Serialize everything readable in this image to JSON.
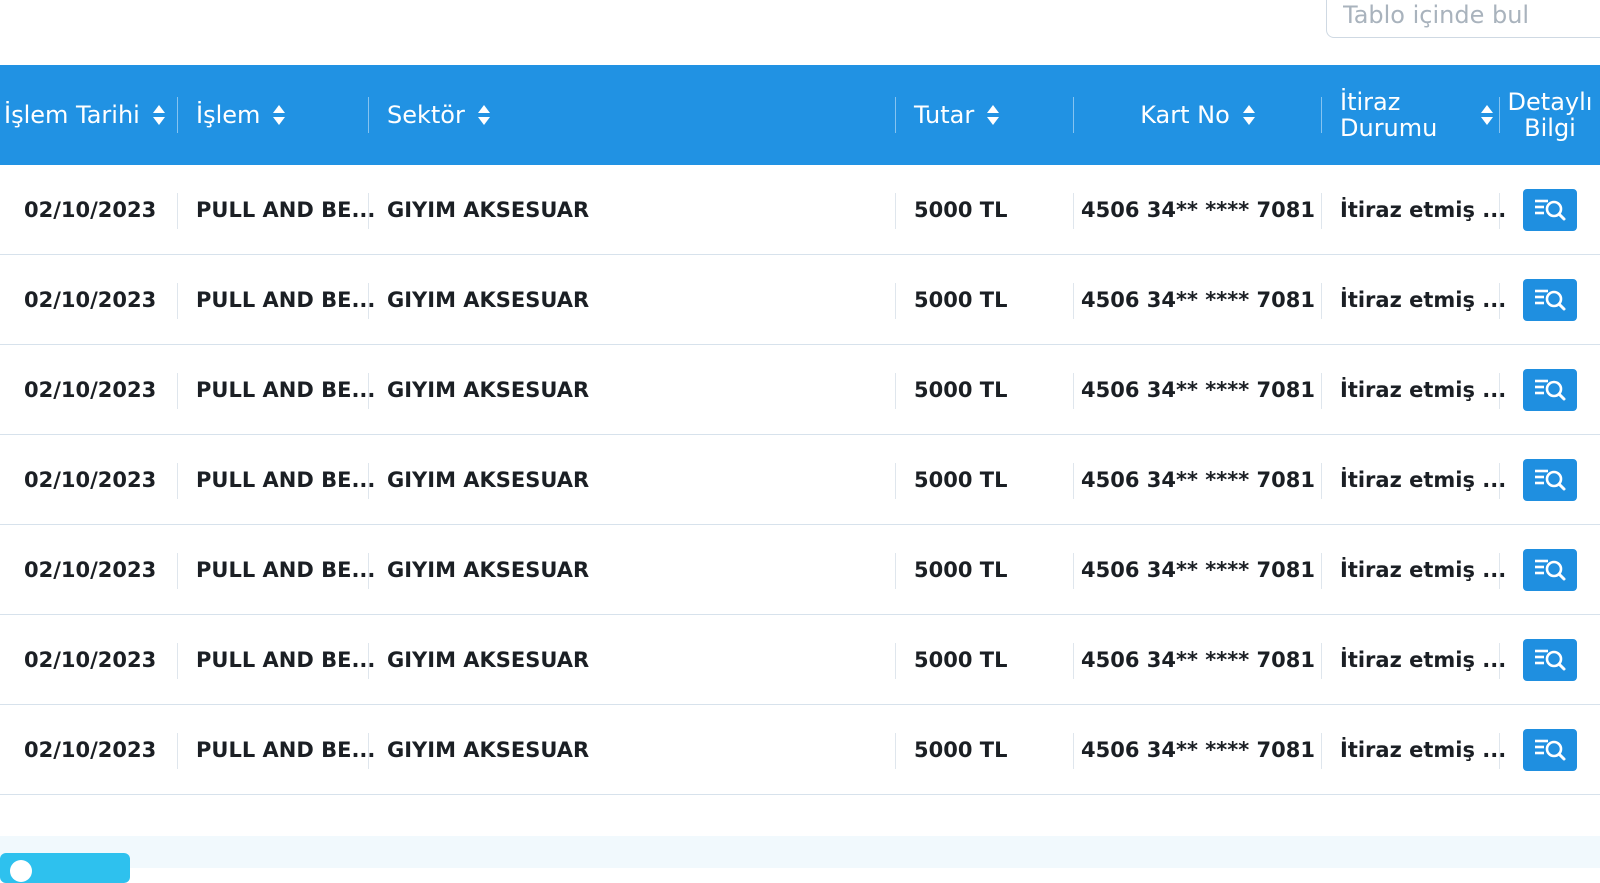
{
  "search": {
    "placeholder": "Tablo içinde bul",
    "icon": "search-icon"
  },
  "colors": {
    "header_bg": "#2192e3",
    "accent": "#1f8fe0",
    "row_border": "#d7e2ec",
    "footer_button": "#2ec1ee"
  },
  "table": {
    "headers": {
      "date": "İşlem Tarihi",
      "transaction": "İşlem",
      "sector": "Sektör",
      "amount": "Tutar",
      "card": "Kart No",
      "objection_line1": "İtiraz",
      "objection_line2": "Durumu",
      "detail_line1": "Detaylı",
      "detail_line2": "Bilgi"
    },
    "rows": [
      {
        "date": "02/10/2023",
        "transaction": "PULL AND BE...",
        "sector": "GIYIM AKSESUAR",
        "amount": "5000 TL",
        "card": "4506 34** **** 7081",
        "objection": "İtiraz etmiş ..."
      },
      {
        "date": "02/10/2023",
        "transaction": "PULL AND BE...",
        "sector": "GIYIM AKSESUAR",
        "amount": "5000 TL",
        "card": "4506 34** **** 7081",
        "objection": "İtiraz etmiş ..."
      },
      {
        "date": "02/10/2023",
        "transaction": "PULL AND BE...",
        "sector": "GIYIM AKSESUAR",
        "amount": "5000 TL",
        "card": "4506 34** **** 7081",
        "objection": "İtiraz etmiş ..."
      },
      {
        "date": "02/10/2023",
        "transaction": "PULL AND BE...",
        "sector": "GIYIM AKSESUAR",
        "amount": "5000 TL",
        "card": "4506 34** **** 7081",
        "objection": "İtiraz etmiş ..."
      },
      {
        "date": "02/10/2023",
        "transaction": "PULL AND BE...",
        "sector": "GIYIM AKSESUAR",
        "amount": "5000 TL",
        "card": "4506 34** **** 7081",
        "objection": "İtiraz etmiş ..."
      },
      {
        "date": "02/10/2023",
        "transaction": "PULL AND BE...",
        "sector": "GIYIM AKSESUAR",
        "amount": "5000 TL",
        "card": "4506 34** **** 7081",
        "objection": "İtiraz etmiş ..."
      },
      {
        "date": "02/10/2023",
        "transaction": "PULL AND BE...",
        "sector": "GIYIM AKSESUAR",
        "amount": "5000 TL",
        "card": "4506 34** **** 7081",
        "objection": "İtiraz etmiş ..."
      }
    ],
    "detail_icon": "detail-search-icon",
    "sort_icon": "sort-icon"
  }
}
